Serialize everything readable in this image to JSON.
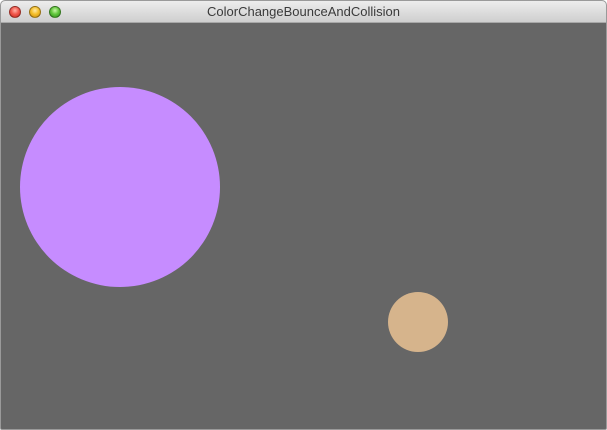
{
  "window": {
    "title": "ColorChangeBounceAndCollision",
    "background_color": "#666666"
  },
  "titlebar": {
    "buttons": [
      {
        "name": "close-button",
        "icon": "close-icon",
        "color": "#f25a4f"
      },
      {
        "name": "minimize-button",
        "icon": "minimize-icon",
        "color": "#f5c02c"
      },
      {
        "name": "zoom-button",
        "icon": "zoom-icon",
        "color": "#63c83e"
      }
    ]
  },
  "canvas": {
    "balls": [
      {
        "name": "large-ball",
        "color": "#c68cff"
      },
      {
        "name": "small-ball",
        "color": "#d6b48c"
      }
    ]
  }
}
